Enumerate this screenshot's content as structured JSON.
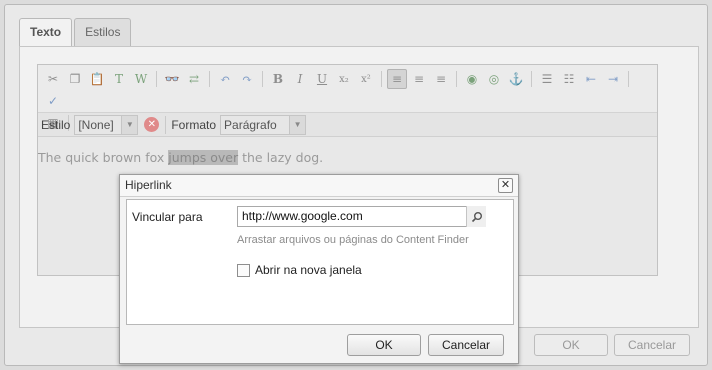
{
  "tabs": [
    {
      "label": "Texto",
      "active": true
    },
    {
      "label": "Estilos",
      "active": false
    }
  ],
  "toolbar": {
    "row1": [
      {
        "icon": "cut-icon",
        "glyph": "✂"
      },
      {
        "icon": "copy-icon",
        "glyph": "❐"
      },
      {
        "icon": "paste-icon",
        "glyph": "📋"
      },
      {
        "icon": "paste-text-icon",
        "glyph": "T"
      },
      {
        "icon": "paste-word-icon",
        "glyph": "W"
      },
      {
        "sep": true
      },
      {
        "icon": "find-icon",
        "glyph": "👓"
      },
      {
        "icon": "replace-icon",
        "glyph": "⇄"
      },
      {
        "sep": true
      },
      {
        "icon": "undo-icon",
        "glyph": "↶"
      },
      {
        "icon": "redo-icon",
        "glyph": "↷"
      },
      {
        "sep": true
      },
      {
        "icon": "bold-icon",
        "glyph": "B"
      },
      {
        "icon": "italic-icon",
        "glyph": "I"
      },
      {
        "icon": "underline-icon",
        "glyph": "U"
      },
      {
        "icon": "subscript-icon",
        "glyph": "x₂"
      },
      {
        "icon": "superscript-icon",
        "glyph": "x²"
      },
      {
        "sep": true
      },
      {
        "icon": "align-left-icon",
        "glyph": "≡",
        "active": true
      },
      {
        "icon": "align-center-icon",
        "glyph": "≡"
      },
      {
        "icon": "align-right-icon",
        "glyph": "≡"
      },
      {
        "sep": true
      },
      {
        "icon": "link-icon",
        "glyph": "◉"
      },
      {
        "icon": "unlink-icon",
        "glyph": "◎"
      },
      {
        "icon": "anchor-icon",
        "glyph": "⚓"
      },
      {
        "sep": true
      },
      {
        "icon": "bullet-list-icon",
        "glyph": "☰"
      },
      {
        "icon": "numbered-list-icon",
        "glyph": "☷"
      },
      {
        "icon": "outdent-icon",
        "glyph": "⇤"
      },
      {
        "icon": "indent-icon",
        "glyph": "⇥"
      },
      {
        "sep": true
      },
      {
        "icon": "spellcheck-icon",
        "glyph": "✓"
      }
    ],
    "row2": [
      {
        "icon": "table-icon",
        "glyph": "▦"
      },
      {
        "sep": true
      },
      {
        "icon": "special-char-icon",
        "glyph": "★"
      },
      {
        "icon": "image-icon",
        "glyph": "▣"
      }
    ]
  },
  "stylebar": {
    "style_label": "Estilo",
    "style_value": "[None]",
    "format_label": "Formato",
    "format_value": "Parágrafo"
  },
  "content": {
    "before": "The quick brown fox ",
    "selected": "jumps over",
    "after": " the lazy dog."
  },
  "outer_buttons": {
    "ok": "OK",
    "cancel": "Cancelar"
  },
  "hyperlink_dialog": {
    "title": "Hiperlink",
    "link_label": "Vincular para",
    "url_value": "http://www.google.com",
    "hint": "Arrastar arquivos ou páginas do Content Finder",
    "new_window_label": "Abrir na nova janela",
    "new_window_checked": false,
    "ok": "OK",
    "cancel": "Cancelar"
  }
}
